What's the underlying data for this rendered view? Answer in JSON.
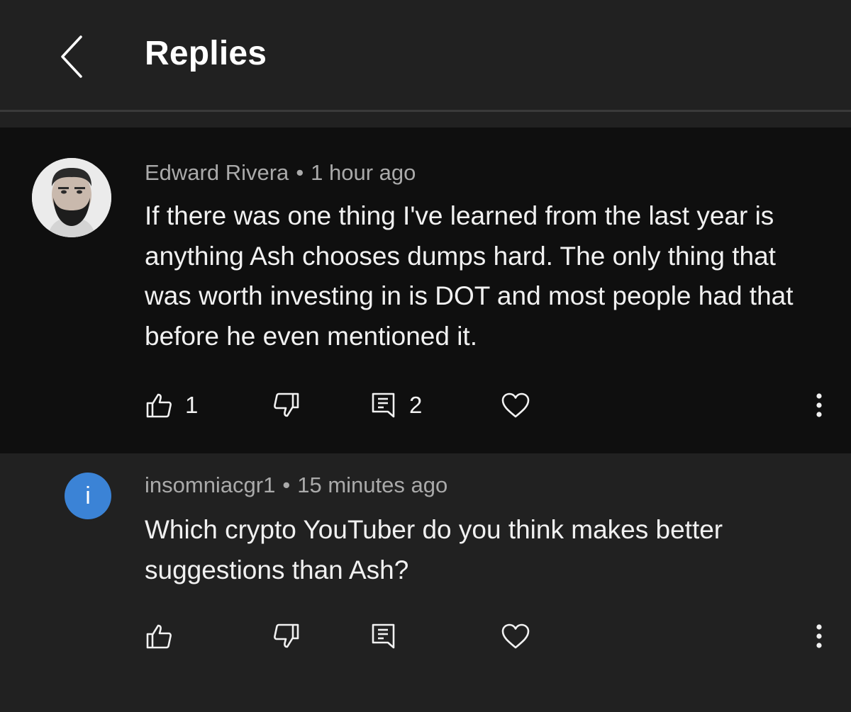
{
  "header": {
    "title": "Replies",
    "back_icon": "back-arrow-icon"
  },
  "parent_comment": {
    "author": "Edward Rivera",
    "separator": "•",
    "time": "1 hour ago",
    "text": "If there was one thing I've learned from the last year is anything Ash chooses dumps hard. The only thing that was worth investing in is DOT and most people had that before he even mentioned it.",
    "like_count": "1",
    "reply_count": "2"
  },
  "reply_comment": {
    "avatar_letter": "i",
    "avatar_color": "#3b83d6",
    "author": "insomniacgr1",
    "separator": "•",
    "time": "15 minutes ago",
    "text": "Which crypto YouTuber do you think makes better suggestions than Ash?"
  },
  "colors": {
    "background": "#212121",
    "highlight_background": "#0f0f0f",
    "meta_text": "#aaaaaa",
    "body_text": "#f1f1f1"
  }
}
